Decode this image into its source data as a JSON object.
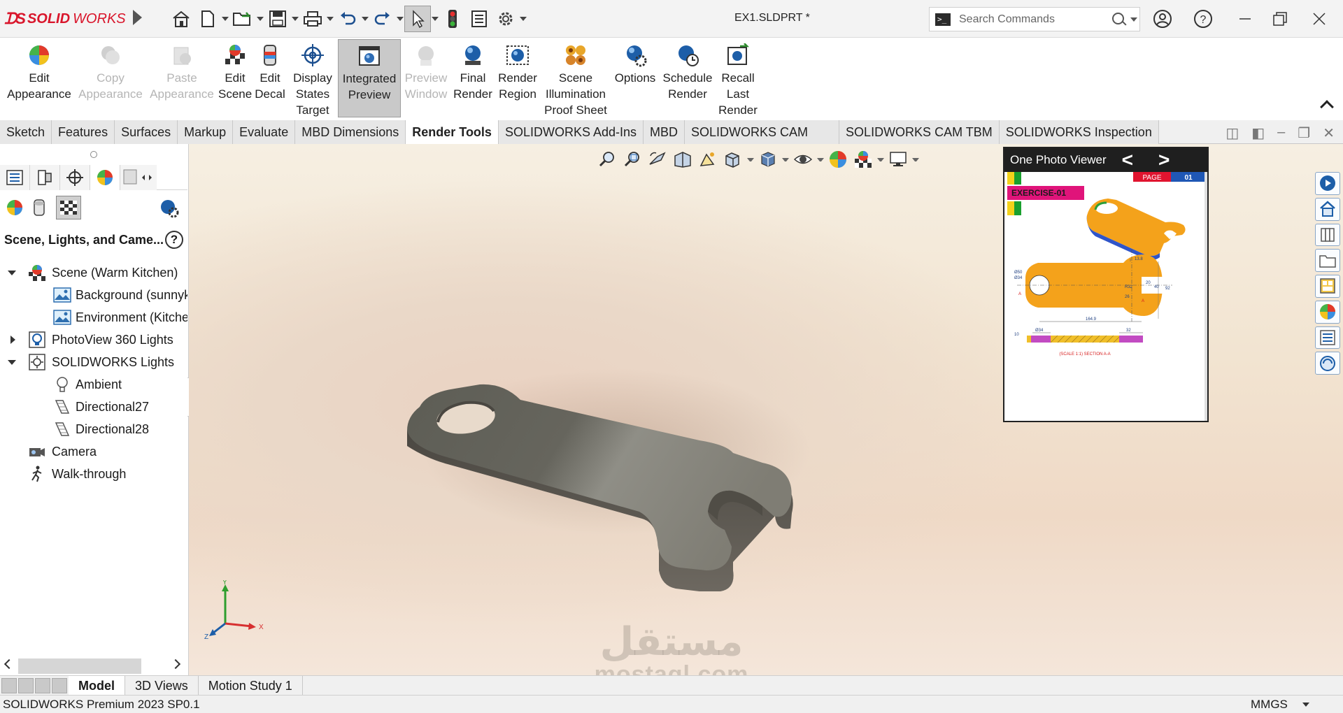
{
  "app": {
    "logo_text_a": "SOLID",
    "logo_text_b": "WORKS",
    "document_title": "EX1.SLDPRT *"
  },
  "search": {
    "placeholder": "Search Commands"
  },
  "window_icons": [
    "user-icon",
    "help-icon",
    "minimize-icon",
    "restore-icon",
    "close-icon"
  ],
  "ribbon": {
    "buttons": [
      {
        "line1": "Edit",
        "line2": "Appearance",
        "line3": "",
        "icon": "edit-appearance-icon",
        "enabled": true
      },
      {
        "line1": "Copy",
        "line2": "Appearance",
        "line3": "",
        "icon": "copy-appearance-icon",
        "enabled": false
      },
      {
        "line1": "Paste",
        "line2": "Appearance",
        "line3": "",
        "icon": "paste-appearance-icon",
        "enabled": false
      },
      {
        "line1": "Edit",
        "line2": "Scene",
        "line3": "",
        "icon": "edit-scene-icon",
        "enabled": true
      },
      {
        "line1": "Edit",
        "line2": "Decal",
        "line3": "",
        "icon": "edit-decal-icon",
        "enabled": true
      },
      {
        "line1": "Display",
        "line2": "States",
        "line3": "Target",
        "icon": "display-states-target-icon",
        "enabled": true
      },
      {
        "line1": "Integrated",
        "line2": "Preview",
        "line3": "",
        "icon": "integrated-preview-icon",
        "enabled": true,
        "active": true
      },
      {
        "line1": "Preview",
        "line2": "Window",
        "line3": "",
        "icon": "preview-window-icon",
        "enabled": false
      },
      {
        "line1": "Final",
        "line2": "Render",
        "line3": "",
        "icon": "final-render-icon",
        "enabled": true
      },
      {
        "line1": "Render",
        "line2": "Region",
        "line3": "",
        "icon": "render-region-icon",
        "enabled": true
      },
      {
        "line1": "Scene",
        "line2": "Illumination",
        "line3": "Proof Sheet",
        "icon": "scene-illumination-icon",
        "enabled": true
      },
      {
        "line1": "Options",
        "line2": "",
        "line3": "",
        "icon": "options-icon",
        "enabled": true
      },
      {
        "line1": "Schedule",
        "line2": "Render",
        "line3": "",
        "icon": "schedule-render-icon",
        "enabled": true
      },
      {
        "line1": "Recall",
        "line2": "Last",
        "line3": "Render",
        "icon": "recall-last-render-icon",
        "enabled": true
      }
    ]
  },
  "tabs": [
    "Sketch",
    "Features",
    "Surfaces",
    "Markup",
    "Evaluate",
    "MBD Dimensions",
    "Render Tools",
    "SOLIDWORKS Add-Ins",
    "MBD",
    "SOLIDWORKS CAM",
    "SOLIDWORKS CAM TBM",
    "SOLIDWORKS Inspection"
  ],
  "active_tab": "Render Tools",
  "panel": {
    "title": "Scene, Lights, and Came...",
    "help": "?",
    "tree": [
      {
        "label": "Scene (Warm Kitchen)",
        "level": 0,
        "expander": "down",
        "icon": "scene-icon"
      },
      {
        "label": "Background (sunnyk",
        "level": 1,
        "expander": "",
        "icon": "background-icon"
      },
      {
        "label": "Environment (Kitche",
        "level": 1,
        "expander": "",
        "icon": "environment-icon"
      },
      {
        "label": "PhotoView 360 Lights",
        "level": 0,
        "expander": "right",
        "icon": "photoview-lights-icon"
      },
      {
        "label": "SOLIDWORKS Lights",
        "level": 0,
        "expander": "down",
        "icon": "solidworks-lights-icon"
      },
      {
        "label": "Ambient",
        "level": 1,
        "expander": "",
        "icon": "ambient-light-icon"
      },
      {
        "label": "Directional27",
        "level": 1,
        "expander": "",
        "icon": "directional-light-icon"
      },
      {
        "label": "Directional28",
        "level": 1,
        "expander": "",
        "icon": "directional-light-icon"
      },
      {
        "label": "Camera",
        "level": 0,
        "expander": "",
        "icon": "camera-icon"
      },
      {
        "label": "Walk-through",
        "level": 0,
        "expander": "",
        "icon": "walk-through-icon"
      }
    ]
  },
  "photo_viewer": {
    "title": "One Photo Viewer",
    "prev": "<",
    "next": ">",
    "page_label": "PAGE",
    "page_number": "01",
    "exercise": "EXERCISE-01",
    "dims": {
      "d1": "13.8",
      "d2": "Ø50",
      "d3": "Ø34",
      "d4": "R32",
      "d5": "20",
      "d6": "40",
      "d7": "26",
      "d8": "92",
      "d9": "164.9",
      "d10": "Ø34",
      "d11": "32",
      "d12": "10",
      "section_a": "A"
    },
    "caption": "(SCALE 1:1) SECTION A-A"
  },
  "triad": {
    "x": "X",
    "y": "Y",
    "z": "Z"
  },
  "watermark": {
    "arabic": "مستقل",
    "latin": "mostaql.com"
  },
  "bottom_tabs": [
    "Model",
    "3D Views",
    "Motion Study 1"
  ],
  "active_bottom_tab": "Model",
  "status": {
    "left": "SOLIDWORKS Premium 2023 SP0.1",
    "units": "MMGS"
  }
}
